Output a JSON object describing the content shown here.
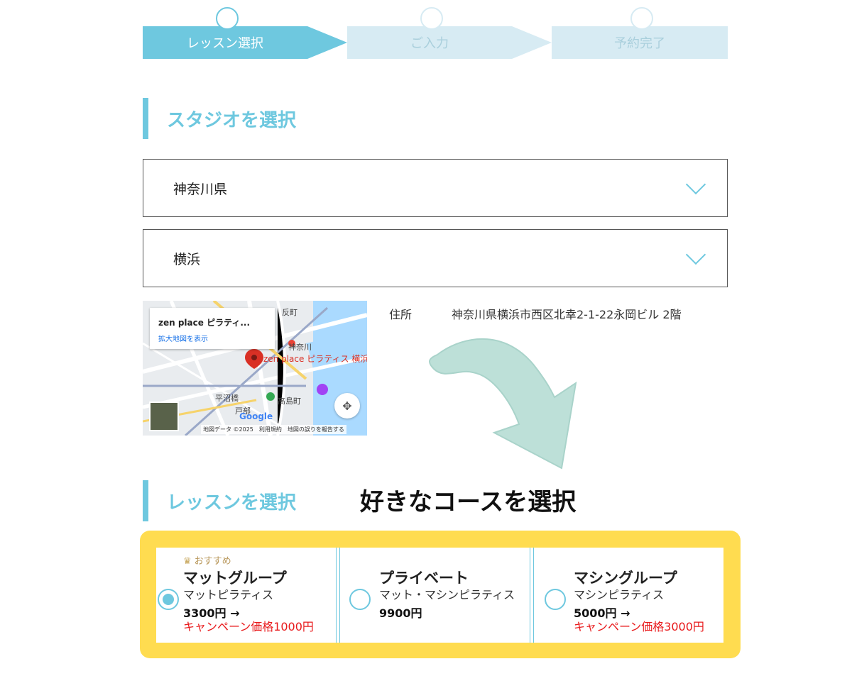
{
  "steps": [
    {
      "label": "レッスン選択"
    },
    {
      "label": "ご入力"
    },
    {
      "label": "予約完了"
    }
  ],
  "studio_section": {
    "title": "スタジオを選択"
  },
  "prefecture_select": {
    "value": "神奈川県"
  },
  "area_select": {
    "value": "横浜"
  },
  "map": {
    "place_name": "zen place ピラティ...",
    "enlarge_link": "拡大地図を表示",
    "pin_label": "zen place ピラティス 横浜",
    "labels": [
      "神奈川",
      "平沼橋",
      "高島町",
      "戸部",
      "反町"
    ],
    "google_logo": "Google",
    "footer": "地図データ ©2025　利用規約　地図の誤りを報告する"
  },
  "address": {
    "label": "住所",
    "value": "神奈川県横浜市西区北幸2-1-22永岡ビル 2階"
  },
  "callout": "好きなコースを選択",
  "lesson_section": {
    "title": "レッスンを選択"
  },
  "lessons": [
    {
      "badge": "おすすめ",
      "title": "マットグループ",
      "subtitle": "マットピラティス",
      "price": "3300円 →",
      "campaign": "キャンペーン価格1000円",
      "selected": true
    },
    {
      "title": "プライベート",
      "subtitle": "マット・マシンピラティス",
      "price": "9900円",
      "selected": false
    },
    {
      "title": "マシングループ",
      "subtitle": "マシンピラティス",
      "price": "5000円 →",
      "campaign": "キャンペーン価格3000円",
      "selected": false
    }
  ],
  "colors": {
    "accent": "#6ec8df",
    "highlight": "#ffdc50",
    "campaign": "#e8191b",
    "arrow": "#bde0d8"
  }
}
